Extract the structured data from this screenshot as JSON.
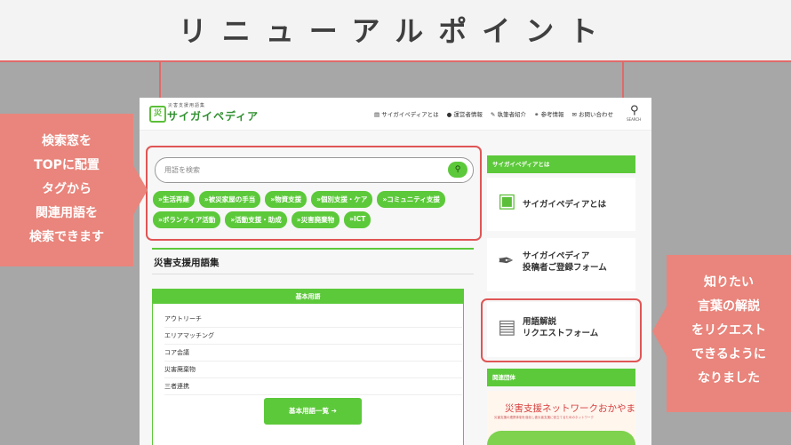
{
  "banner": {
    "title": "リニューアルポイント"
  },
  "site": {
    "logo": {
      "mark": "災",
      "sub": "災害支援用語集",
      "main": "サイガイペディア"
    },
    "nav": [
      {
        "label": "サイガイペディアとは"
      },
      {
        "label": "運営者情報"
      },
      {
        "label": "執筆者紹介"
      },
      {
        "label": "参考情報"
      },
      {
        "label": "お問い合わせ"
      }
    ],
    "search_icon": "search-icon",
    "search_label": "SEARCH",
    "search": {
      "placeholder": "用語を検索"
    },
    "tags": [
      "»生活再建",
      "»被災家屋の手当",
      "»物資支援",
      "»個別支援・ケア",
      "»コミュニティ支援",
      "»ボランティア活動",
      "»活動支援・助成",
      "»災害廃棄物",
      "»ICT"
    ],
    "section_title": "災害支援用語集",
    "terms": {
      "header": "基本用語",
      "items": [
        "アウトリーチ",
        "エリアマッチング",
        "コア会議",
        "災害廃棄物",
        "三者連携"
      ],
      "more_button": "基本用語一覧 ➔"
    },
    "sidebar": {
      "about_heading": "サイガイペディアとは",
      "cards": [
        {
          "label": "サイガイペディアとは",
          "icon": "logo-icon"
        },
        {
          "label": "サイガイペディア\n投稿者ご登録フォーム",
          "icon": "pen-icon"
        },
        {
          "label": "用語解説\nリクエストフォーム",
          "icon": "document-icon"
        }
      ],
      "related_heading": "関連団体",
      "related_banner": "災害支援ネットワークおかやま",
      "related_banner_sub": "災害支援の連携体制を強化し被災者支援に役立てるためのネットワーク"
    }
  },
  "callouts": {
    "left": [
      "検索窓を",
      "TOPに配置",
      "タグから",
      "関連用語を",
      "検索できます"
    ],
    "right": [
      "知りたい",
      "言葉の解説",
      "をリクエスト",
      "できるように",
      "なりました"
    ]
  },
  "colors": {
    "accent": "#5cc93a",
    "highlight": "#e05555",
    "callout": "#e9857c"
  }
}
